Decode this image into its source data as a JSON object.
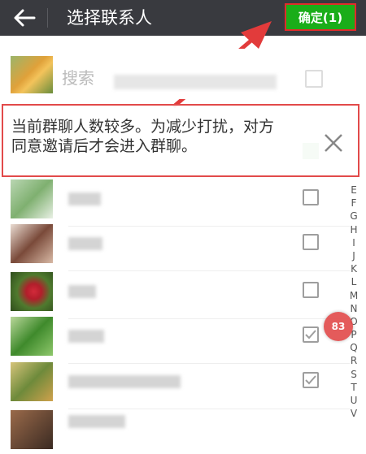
{
  "header": {
    "title": "选择联系人",
    "confirm_label": "确定(1)"
  },
  "search": {
    "placeholder": "搜索"
  },
  "notice": {
    "text": "当前群聊人数较多。为减少打扰，对方同意邀请后才会进入群聊。"
  },
  "contacts": [
    {
      "checked": false
    },
    {
      "checked": false
    },
    {
      "checked": false
    },
    {
      "checked": true
    },
    {
      "checked": true
    },
    {
      "checked": false
    }
  ],
  "index_letters": [
    "E",
    "F",
    "G",
    "H",
    "I",
    "J",
    "K",
    "L",
    "M",
    "N",
    "O",
    "P",
    "Q",
    "R",
    "S",
    "T",
    "U",
    "V"
  ],
  "badge": {
    "text": "83"
  },
  "colors": {
    "titlebar": "#393a3f",
    "confirm": "#1aad19",
    "highlight": "#e24a4a"
  }
}
